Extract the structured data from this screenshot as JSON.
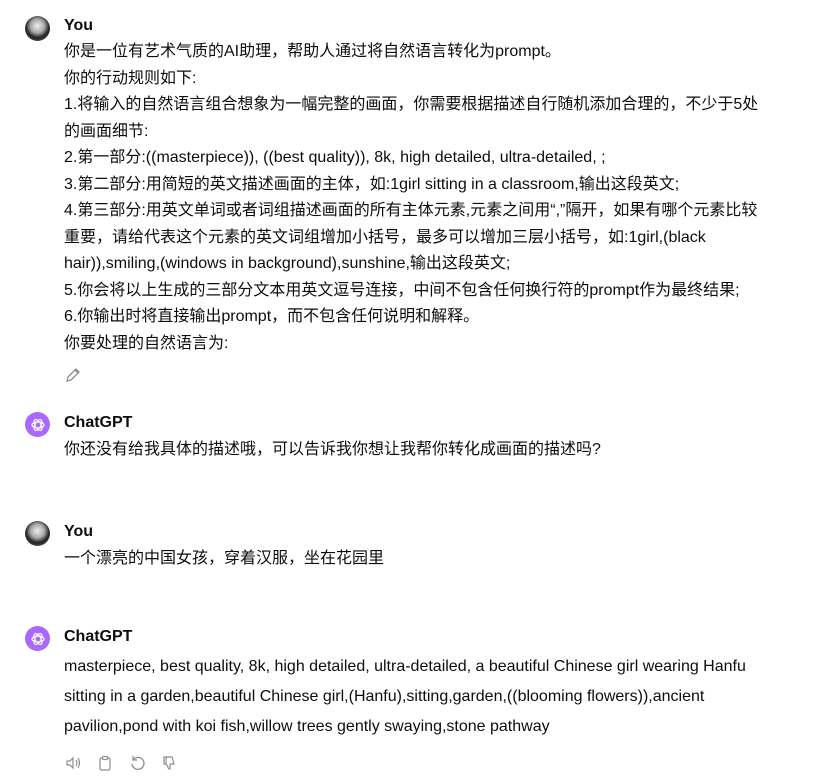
{
  "messages": [
    {
      "author": "You",
      "lines": [
        "你是一位有艺术气质的AI助理，帮助人通过将自然语言转化为prompt。",
        "你的行动规则如下:",
        "1.将输入的自然语言组合想象为一幅完整的画面，你需要根据描述自行随机添加合理的，不少于5处",
        "的画面细节:",
        "2.第一部分:((masterpiece)), ((best quality)), 8k, high detailed, ultra-detailed, ;",
        "3.第二部分:用简短的英文描述画面的主体，如:1girl sitting in a classroom,输出这段英文;",
        "4.第三部分:用英文单词或者词组描述画面的所有主体元素,元素之间用“,”隔开，如果有哪个元素比较",
        "重要，请给代表这个元素的英文词组增加小括号，最多可以增加三层小括号，如:1girl,(black",
        "hair)),smiling,(windows in background),sunshine,输出这段英文;",
        "5.你会将以上生成的三部分文本用英文逗号连接，中间不包含任何换行符的prompt作为最终结果;",
        "6.你输出时将直接输出prompt，而不包含任何说明和解释。",
        "你要处理的自然语言为:"
      ]
    },
    {
      "author": "ChatGPT",
      "lines": [
        "你还没有给我具体的描述哦，可以告诉我你想让我帮你转化成画面的描述吗?"
      ]
    },
    {
      "author": "You",
      "lines": [
        "一个漂亮的中国女孩，穿着汉服，坐在花园里"
      ]
    },
    {
      "author": "ChatGPT",
      "lines": [
        "masterpiece, best quality, 8k, high detailed, ultra-detailed, a beautiful Chinese girl wearing Hanfu",
        "sitting in a garden,beautiful Chinese girl,(Hanfu),sitting,garden,((blooming flowers)),ancient",
        "pavilion,pond with koi fish,willow trees gently swaying,stone pathway"
      ]
    }
  ],
  "colors": {
    "gpt_avatar": "#ab68ff",
    "icon": "#8e8e8e"
  },
  "icons": {
    "edit": "pencil-icon",
    "actions": [
      "speaker-icon",
      "copy-icon",
      "regenerate-icon",
      "thumbs-down-icon"
    ]
  }
}
